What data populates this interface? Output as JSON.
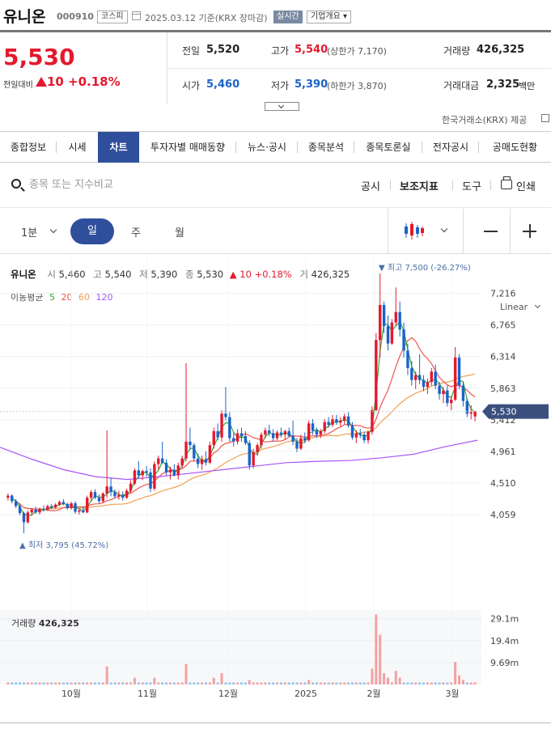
{
  "header": {
    "stock_name": "유니온",
    "stock_code": "000910",
    "market_badge": "코스피",
    "date_text": "2025.03.12  기준(KRX 장마감)",
    "live_badge": "실시간",
    "info_button": "기업개요 ▾"
  },
  "price": {
    "current": "5,530",
    "change_label": "전일대비",
    "change_value": "10",
    "change_percent": "+0.18%"
  },
  "summary": {
    "prev_label": "전일",
    "prev_value": "5,520",
    "high_label": "고가",
    "high_value": "5,540",
    "upper_limit": "(상한가 7,170)",
    "volume_label": "거래량",
    "volume_value": "426,325",
    "open_label": "시가",
    "open_value": "5,460",
    "low_label": "저가",
    "low_value": "5,390",
    "lower_limit": "(하한가 3,870)",
    "amount_label": "거래대금",
    "amount_value": "2,325",
    "amount_unit": "백만"
  },
  "source": "한국거래소(KRX) 제공",
  "tabs": [
    "종합정보",
    "시세",
    "차트",
    "투자자별 매매동향",
    "뉴스·공시",
    "종목분석",
    "종목토론실",
    "전자공시",
    "공매도현황"
  ],
  "active_tab": 2,
  "search": {
    "placeholder": "종목 또는 지수비교"
  },
  "tools": {
    "notice": "공시",
    "indicator": "보조지표",
    "tool": "도구",
    "print": "인쇄"
  },
  "periods": {
    "minute": "1분",
    "day": "일",
    "week": "주",
    "month": "월"
  },
  "ohlc_legend": {
    "name": "유니온",
    "open_label": "시",
    "open": "5,460",
    "high_label": "고",
    "high": "5,540",
    "low_label": "저",
    "low": "5,390",
    "close_label": "종",
    "close": "5,530",
    "change": "▲ 10 +0.18%",
    "vol_label": "거",
    "vol": "426,325"
  },
  "moving_avg": {
    "label": "이동평균",
    "p5": "5",
    "p20": "20",
    "p60": "60",
    "p120": "120"
  },
  "scale_mode": "Linear",
  "colors": {
    "up": "#e4192e",
    "down": "#1a63c8",
    "accent": "#2f4f9c",
    "ma5": "#35a935",
    "ma20": "#ef5350",
    "ma60": "#f0a050",
    "ma120": "#a855f7",
    "vol_up": "#f2a2a2",
    "vol_down": "#8fc3ea"
  },
  "chart_data": {
    "type": "candlestick",
    "y_ticks": [
      4059,
      4510,
      4961,
      5412,
      5863,
      6314,
      6765,
      7216
    ],
    "x_ticks": [
      "10월",
      "11월",
      "12월",
      "2025",
      "2월",
      "3월"
    ],
    "current_price": 5530,
    "current_price_label": "5,530",
    "max_annotation": "▼ 최고 7,500 (-26.27%)",
    "min_annotation": "▲ 최저 3,795 (45.72%)",
    "volume_label": "거래량",
    "volume_value": "426,325",
    "volume_ticks": [
      "29.1m",
      "19.4m",
      "9.69m"
    ],
    "volume_tick_values": [
      29.1,
      19.4,
      9.69
    ],
    "ylim": [
      3700,
      7700
    ],
    "volume_max": 34,
    "candles": [
      {
        "x": 0.5,
        "o": 4300,
        "h": 4360,
        "l": 4260,
        "c": 4330
      },
      {
        "x": 1,
        "o": 4330,
        "h": 4350,
        "l": 4220,
        "c": 4250
      },
      {
        "x": 1.5,
        "o": 4250,
        "h": 4280,
        "l": 4150,
        "c": 4180
      },
      {
        "x": 2,
        "o": 4180,
        "h": 4220,
        "l": 4050,
        "c": 4080
      },
      {
        "x": 2.5,
        "o": 4080,
        "h": 4100,
        "l": 3795,
        "c": 3950
      },
      {
        "x": 3,
        "o": 3950,
        "h": 4120,
        "l": 3930,
        "c": 4090
      },
      {
        "x": 3.5,
        "o": 4090,
        "h": 4150,
        "l": 4040,
        "c": 4130
      },
      {
        "x": 4,
        "o": 4130,
        "h": 4170,
        "l": 4070,
        "c": 4090
      },
      {
        "x": 4.5,
        "o": 4090,
        "h": 4160,
        "l": 4060,
        "c": 4140
      },
      {
        "x": 5,
        "o": 4140,
        "h": 4190,
        "l": 4100,
        "c": 4130
      },
      {
        "x": 5.5,
        "o": 4130,
        "h": 4200,
        "l": 4110,
        "c": 4180
      },
      {
        "x": 6,
        "o": 4180,
        "h": 4210,
        "l": 4140,
        "c": 4160
      },
      {
        "x": 6.5,
        "o": 4160,
        "h": 4220,
        "l": 4140,
        "c": 4200
      },
      {
        "x": 7,
        "o": 4200,
        "h": 4260,
        "l": 4180,
        "c": 4240
      },
      {
        "x": 7.5,
        "o": 4240,
        "h": 4280,
        "l": 4190,
        "c": 4210
      },
      {
        "x": 8,
        "o": 4210,
        "h": 4230,
        "l": 4130,
        "c": 4150
      },
      {
        "x": 8.5,
        "o": 4150,
        "h": 4240,
        "l": 4130,
        "c": 4220
      },
      {
        "x": 9,
        "o": 4220,
        "h": 4250,
        "l": 4070,
        "c": 4100
      },
      {
        "x": 9.5,
        "o": 4100,
        "h": 4150,
        "l": 4060,
        "c": 4120
      },
      {
        "x": 10,
        "o": 4120,
        "h": 4170,
        "l": 4080,
        "c": 4090
      },
      {
        "x": 10.5,
        "o": 4090,
        "h": 4330,
        "l": 4080,
        "c": 4300
      },
      {
        "x": 11,
        "o": 4300,
        "h": 4410,
        "l": 4260,
        "c": 4380
      },
      {
        "x": 11.5,
        "o": 4380,
        "h": 4420,
        "l": 4280,
        "c": 4300
      },
      {
        "x": 12,
        "o": 4300,
        "h": 4350,
        "l": 4220,
        "c": 4250
      },
      {
        "x": 12.5,
        "o": 4250,
        "h": 4380,
        "l": 4230,
        "c": 4360
      },
      {
        "x": 13,
        "o": 4360,
        "h": 5260,
        "l": 4300,
        "c": 4460
      },
      {
        "x": 13.5,
        "o": 4460,
        "h": 4580,
        "l": 4320,
        "c": 4380
      },
      {
        "x": 14,
        "o": 4380,
        "h": 4420,
        "l": 4290,
        "c": 4320
      },
      {
        "x": 14.5,
        "o": 4320,
        "h": 4400,
        "l": 4270,
        "c": 4340
      },
      {
        "x": 15,
        "o": 4340,
        "h": 4390,
        "l": 4260,
        "c": 4300
      },
      {
        "x": 15.5,
        "o": 4300,
        "h": 4430,
        "l": 4280,
        "c": 4400
      },
      {
        "x": 16,
        "o": 4400,
        "h": 4550,
        "l": 4370,
        "c": 4500
      },
      {
        "x": 16.5,
        "o": 4500,
        "h": 4720,
        "l": 4480,
        "c": 4690
      },
      {
        "x": 17,
        "o": 4690,
        "h": 4820,
        "l": 4580,
        "c": 4620
      },
      {
        "x": 17.5,
        "o": 4620,
        "h": 4700,
        "l": 4550,
        "c": 4680
      },
      {
        "x": 18,
        "o": 4680,
        "h": 4750,
        "l": 4600,
        "c": 4660
      },
      {
        "x": 18.5,
        "o": 4660,
        "h": 4720,
        "l": 4380,
        "c": 4430
      },
      {
        "x": 19,
        "o": 4430,
        "h": 4820,
        "l": 4400,
        "c": 4780
      },
      {
        "x": 19.5,
        "o": 4780,
        "h": 4900,
        "l": 4700,
        "c": 4860
      },
      {
        "x": 20,
        "o": 4860,
        "h": 5100,
        "l": 4780,
        "c": 4800
      },
      {
        "x": 20.5,
        "o": 4800,
        "h": 4850,
        "l": 4620,
        "c": 4660
      },
      {
        "x": 21,
        "o": 4660,
        "h": 4740,
        "l": 4560,
        "c": 4700
      },
      {
        "x": 21.5,
        "o": 4700,
        "h": 4780,
        "l": 4600,
        "c": 4620
      },
      {
        "x": 22,
        "o": 4620,
        "h": 4800,
        "l": 4560,
        "c": 4760
      },
      {
        "x": 22.5,
        "o": 4760,
        "h": 4900,
        "l": 4730,
        "c": 4860
      },
      {
        "x": 23,
        "o": 4860,
        "h": 6220,
        "l": 4820,
        "c": 5100
      },
      {
        "x": 23.5,
        "o": 5100,
        "h": 5300,
        "l": 4980,
        "c": 5050
      },
      {
        "x": 24,
        "o": 5050,
        "h": 5080,
        "l": 4830,
        "c": 4860
      },
      {
        "x": 24.5,
        "o": 4860,
        "h": 4930,
        "l": 4720,
        "c": 4780
      },
      {
        "x": 25,
        "o": 4780,
        "h": 4900,
        "l": 4700,
        "c": 4850
      },
      {
        "x": 25.5,
        "o": 4850,
        "h": 4960,
        "l": 4760,
        "c": 4800
      },
      {
        "x": 26,
        "o": 4800,
        "h": 5100,
        "l": 4780,
        "c": 5050
      },
      {
        "x": 26.5,
        "o": 5050,
        "h": 5300,
        "l": 5000,
        "c": 5250
      },
      {
        "x": 27,
        "o": 5250,
        "h": 5360,
        "l": 5120,
        "c": 5160
      },
      {
        "x": 27.5,
        "o": 5160,
        "h": 5550,
        "l": 5100,
        "c": 5500
      },
      {
        "x": 28,
        "o": 5500,
        "h": 5880,
        "l": 5400,
        "c": 5450
      },
      {
        "x": 28.5,
        "o": 5450,
        "h": 5520,
        "l": 5100,
        "c": 5150
      },
      {
        "x": 29,
        "o": 5150,
        "h": 5230,
        "l": 5030,
        "c": 5100
      },
      {
        "x": 29.5,
        "o": 5100,
        "h": 5280,
        "l": 5060,
        "c": 5220
      },
      {
        "x": 30,
        "o": 5220,
        "h": 5300,
        "l": 5100,
        "c": 5180
      },
      {
        "x": 30.5,
        "o": 5180,
        "h": 5250,
        "l": 5050,
        "c": 5080
      },
      {
        "x": 31,
        "o": 5080,
        "h": 5120,
        "l": 4700,
        "c": 4760
      },
      {
        "x": 31.5,
        "o": 4760,
        "h": 5000,
        "l": 4720,
        "c": 4950
      },
      {
        "x": 32,
        "o": 4950,
        "h": 5080,
        "l": 4900,
        "c": 5050
      },
      {
        "x": 32.5,
        "o": 5050,
        "h": 5230,
        "l": 5000,
        "c": 5200
      },
      {
        "x": 33,
        "o": 5200,
        "h": 5300,
        "l": 5150,
        "c": 5260
      },
      {
        "x": 33.5,
        "o": 5260,
        "h": 5340,
        "l": 5180,
        "c": 5220
      },
      {
        "x": 34,
        "o": 5220,
        "h": 5280,
        "l": 5100,
        "c": 5150
      },
      {
        "x": 34.5,
        "o": 5150,
        "h": 5260,
        "l": 5120,
        "c": 5230
      },
      {
        "x": 35,
        "o": 5230,
        "h": 5300,
        "l": 5160,
        "c": 5200
      },
      {
        "x": 35.5,
        "o": 5200,
        "h": 5270,
        "l": 5130,
        "c": 5250
      },
      {
        "x": 36,
        "o": 5250,
        "h": 5300,
        "l": 5160,
        "c": 5180
      },
      {
        "x": 36.5,
        "o": 5180,
        "h": 5400,
        "l": 5050,
        "c": 5100
      },
      {
        "x": 37,
        "o": 5100,
        "h": 5150,
        "l": 4950,
        "c": 5000
      },
      {
        "x": 37.5,
        "o": 5000,
        "h": 5200,
        "l": 4980,
        "c": 5150
      },
      {
        "x": 38,
        "o": 5150,
        "h": 5230,
        "l": 5080,
        "c": 5120
      },
      {
        "x": 38.5,
        "o": 5120,
        "h": 5400,
        "l": 5100,
        "c": 5360
      },
      {
        "x": 39,
        "o": 5360,
        "h": 5420,
        "l": 5200,
        "c": 5260
      },
      {
        "x": 39.5,
        "o": 5260,
        "h": 5300,
        "l": 5150,
        "c": 5200
      },
      {
        "x": 40,
        "o": 5200,
        "h": 5280,
        "l": 5150,
        "c": 5250
      },
      {
        "x": 40.5,
        "o": 5250,
        "h": 5420,
        "l": 5220,
        "c": 5380
      },
      {
        "x": 41,
        "o": 5380,
        "h": 5450,
        "l": 5300,
        "c": 5340
      },
      {
        "x": 41.5,
        "o": 5340,
        "h": 5480,
        "l": 5310,
        "c": 5420
      },
      {
        "x": 42,
        "o": 5420,
        "h": 5480,
        "l": 5340,
        "c": 5370
      },
      {
        "x": 42.5,
        "o": 5370,
        "h": 5450,
        "l": 5320,
        "c": 5400
      },
      {
        "x": 43,
        "o": 5400,
        "h": 5500,
        "l": 5350,
        "c": 5460
      },
      {
        "x": 43.5,
        "o": 5460,
        "h": 5520,
        "l": 5300,
        "c": 5330
      },
      {
        "x": 44,
        "o": 5330,
        "h": 5380,
        "l": 5130,
        "c": 5160
      },
      {
        "x": 44.5,
        "o": 5160,
        "h": 5260,
        "l": 5080,
        "c": 5220
      },
      {
        "x": 45,
        "o": 5220,
        "h": 5280,
        "l": 5150,
        "c": 5200
      },
      {
        "x": 45.5,
        "o": 5200,
        "h": 5240,
        "l": 5080,
        "c": 5120
      },
      {
        "x": 46,
        "o": 5120,
        "h": 5260,
        "l": 5070,
        "c": 5240
      },
      {
        "x": 46.5,
        "o": 5240,
        "h": 5600,
        "l": 5200,
        "c": 5550
      },
      {
        "x": 47,
        "o": 5550,
        "h": 6650,
        "l": 5530,
        "c": 6550
      },
      {
        "x": 47.5,
        "o": 6550,
        "h": 7500,
        "l": 6300,
        "c": 7050
      },
      {
        "x": 48,
        "o": 7050,
        "h": 7100,
        "l": 6650,
        "c": 6750
      },
      {
        "x": 48.5,
        "o": 6750,
        "h": 6900,
        "l": 6400,
        "c": 6500
      },
      {
        "x": 49,
        "o": 6500,
        "h": 6850,
        "l": 6480,
        "c": 6800
      },
      {
        "x": 49.5,
        "o": 6800,
        "h": 7300,
        "l": 6750,
        "c": 6950
      },
      {
        "x": 50,
        "o": 6950,
        "h": 7100,
        "l": 6600,
        "c": 6700
      },
      {
        "x": 50.5,
        "o": 6700,
        "h": 6800,
        "l": 6300,
        "c": 6400
      },
      {
        "x": 51,
        "o": 6400,
        "h": 6500,
        "l": 6050,
        "c": 6150
      },
      {
        "x": 51.5,
        "o": 6150,
        "h": 6250,
        "l": 5900,
        "c": 5980
      },
      {
        "x": 52,
        "o": 5980,
        "h": 6100,
        "l": 5850,
        "c": 6050
      },
      {
        "x": 52.5,
        "o": 6050,
        "h": 6350,
        "l": 5920,
        "c": 5980
      },
      {
        "x": 53,
        "o": 5980,
        "h": 6050,
        "l": 5820,
        "c": 5880
      },
      {
        "x": 53.5,
        "o": 5880,
        "h": 6000,
        "l": 5780,
        "c": 5950
      },
      {
        "x": 54,
        "o": 5950,
        "h": 6150,
        "l": 5900,
        "c": 6100
      },
      {
        "x": 54.5,
        "o": 6100,
        "h": 6200,
        "l": 5850,
        "c": 5900
      },
      {
        "x": 55,
        "o": 5900,
        "h": 5950,
        "l": 5700,
        "c": 5780
      },
      {
        "x": 55.5,
        "o": 5780,
        "h": 5880,
        "l": 5650,
        "c": 5830
      },
      {
        "x": 56,
        "o": 5830,
        "h": 5900,
        "l": 5600,
        "c": 5650
      },
      {
        "x": 56.5,
        "o": 5650,
        "h": 5750,
        "l": 5550,
        "c": 5700
      },
      {
        "x": 57,
        "o": 5700,
        "h": 6450,
        "l": 5680,
        "c": 6300
      },
      {
        "x": 57.5,
        "o": 6300,
        "h": 6350,
        "l": 5850,
        "c": 5900
      },
      {
        "x": 58,
        "o": 5900,
        "h": 5950,
        "l": 5600,
        "c": 5680
      },
      {
        "x": 58.5,
        "o": 5680,
        "h": 5720,
        "l": 5450,
        "c": 5500
      },
      {
        "x": 59,
        "o": 5500,
        "h": 5620,
        "l": 5420,
        "c": 5520
      },
      {
        "x": 59.5,
        "o": 5460,
        "h": 5540,
        "l": 5390,
        "c": 5530
      }
    ],
    "volumes": [
      {
        "x": 13,
        "v": 8
      },
      {
        "x": 16.5,
        "v": 3
      },
      {
        "x": 19,
        "v": 3
      },
      {
        "x": 23,
        "v": 9
      },
      {
        "x": 26.5,
        "v": 3
      },
      {
        "x": 27.5,
        "v": 5
      },
      {
        "x": 31,
        "v": 2
      },
      {
        "x": 38.5,
        "v": 2
      },
      {
        "x": 46.5,
        "v": 7
      },
      {
        "x": 47,
        "v": 31
      },
      {
        "x": 47.5,
        "v": 22
      },
      {
        "x": 48,
        "v": 5
      },
      {
        "x": 48.5,
        "v": 3
      },
      {
        "x": 49.5,
        "v": 6
      },
      {
        "x": 50,
        "v": 3
      },
      {
        "x": 57,
        "v": 10
      },
      {
        "x": 57.5,
        "v": 4
      },
      {
        "x": 58,
        "v": 2
      }
    ]
  }
}
